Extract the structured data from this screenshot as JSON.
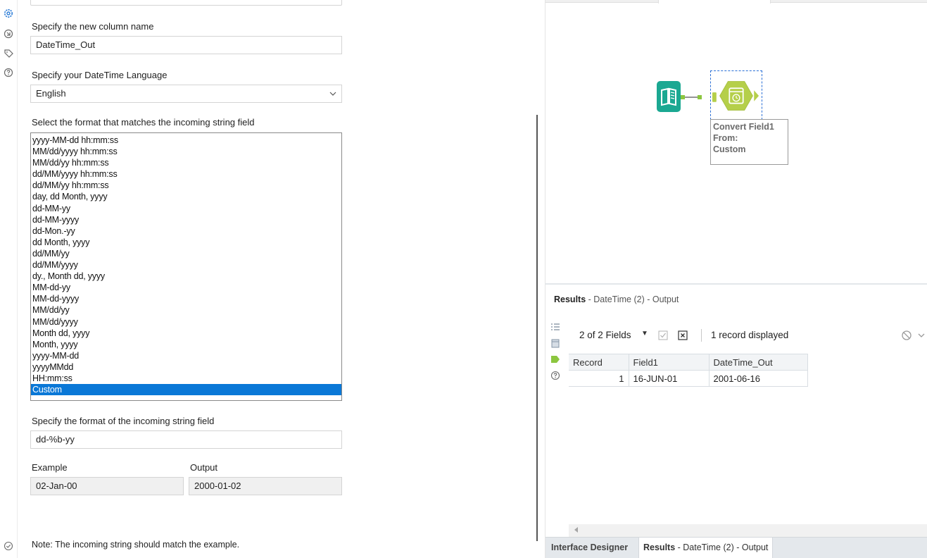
{
  "rail": {
    "icons": [
      "gear-icon",
      "connection-icon",
      "tag-icon",
      "help-icon"
    ],
    "accent": "#2a7bd6"
  },
  "config": {
    "new_column_label": "Specify the new column name",
    "new_column_value": "DateTime_Out",
    "language_label": "Specify your DateTime Language",
    "language_value": "English",
    "format_list_label": "Select the format that matches the incoming string field",
    "formats": [
      "yyyy-MM-dd hh:mm:ss",
      "MM/dd/yyyy hh:mm:ss",
      "MM/dd/yy hh:mm:ss",
      "dd/MM/yyyy hh:mm:ss",
      "dd/MM/yy hh:mm:ss",
      "day, dd Month, yyyy",
      "dd-MM-yy",
      "dd-MM-yyyy",
      "dd-Mon.-yy",
      "dd Month, yyyy",
      "dd/MM/yy",
      "dd/MM/yyyy",
      "dy., Month dd, yyyy",
      "MM-dd-yy",
      "MM-dd-yyyy",
      "MM/dd/yy",
      "MM/dd/yyyy",
      "Month dd, yyyy",
      "Month, yyyy",
      "yyyy-MM-dd",
      "yyyyMMdd",
      "HH:mm:ss",
      "Custom"
    ],
    "selected_format": "Custom",
    "custom_format_label": "Specify the format of the incoming string field",
    "custom_format_value": "dd-%b-yy",
    "example_label": "Example",
    "example_value": "02-Jan-00",
    "output_label": "Output",
    "output_value": "2000-01-02",
    "note": "Note: The incoming string should match the example."
  },
  "canvas": {
    "annotation": [
      "Convert Field1",
      "From:",
      "Custom"
    ],
    "input_tool_color": "#1ba892",
    "datetime_tool_color": "#b5cf4a",
    "connector_color": "#8cc63f"
  },
  "results": {
    "title_bold": "Results",
    "title_rest": " - DateTime (2) - Output",
    "fields_count": "2 of 2 Fields",
    "records_status": "1 record displayed",
    "columns": [
      "Record",
      "Field1",
      "DateTime_Out"
    ],
    "rows": [
      {
        "record": "1",
        "field1": "16-JUN-01",
        "datetime_out": "2001-06-16"
      }
    ]
  },
  "bottom_tabs": {
    "designer": "Interface Designer",
    "results_bold": "Results",
    "results_rest": " - DateTime (2) - Output"
  }
}
